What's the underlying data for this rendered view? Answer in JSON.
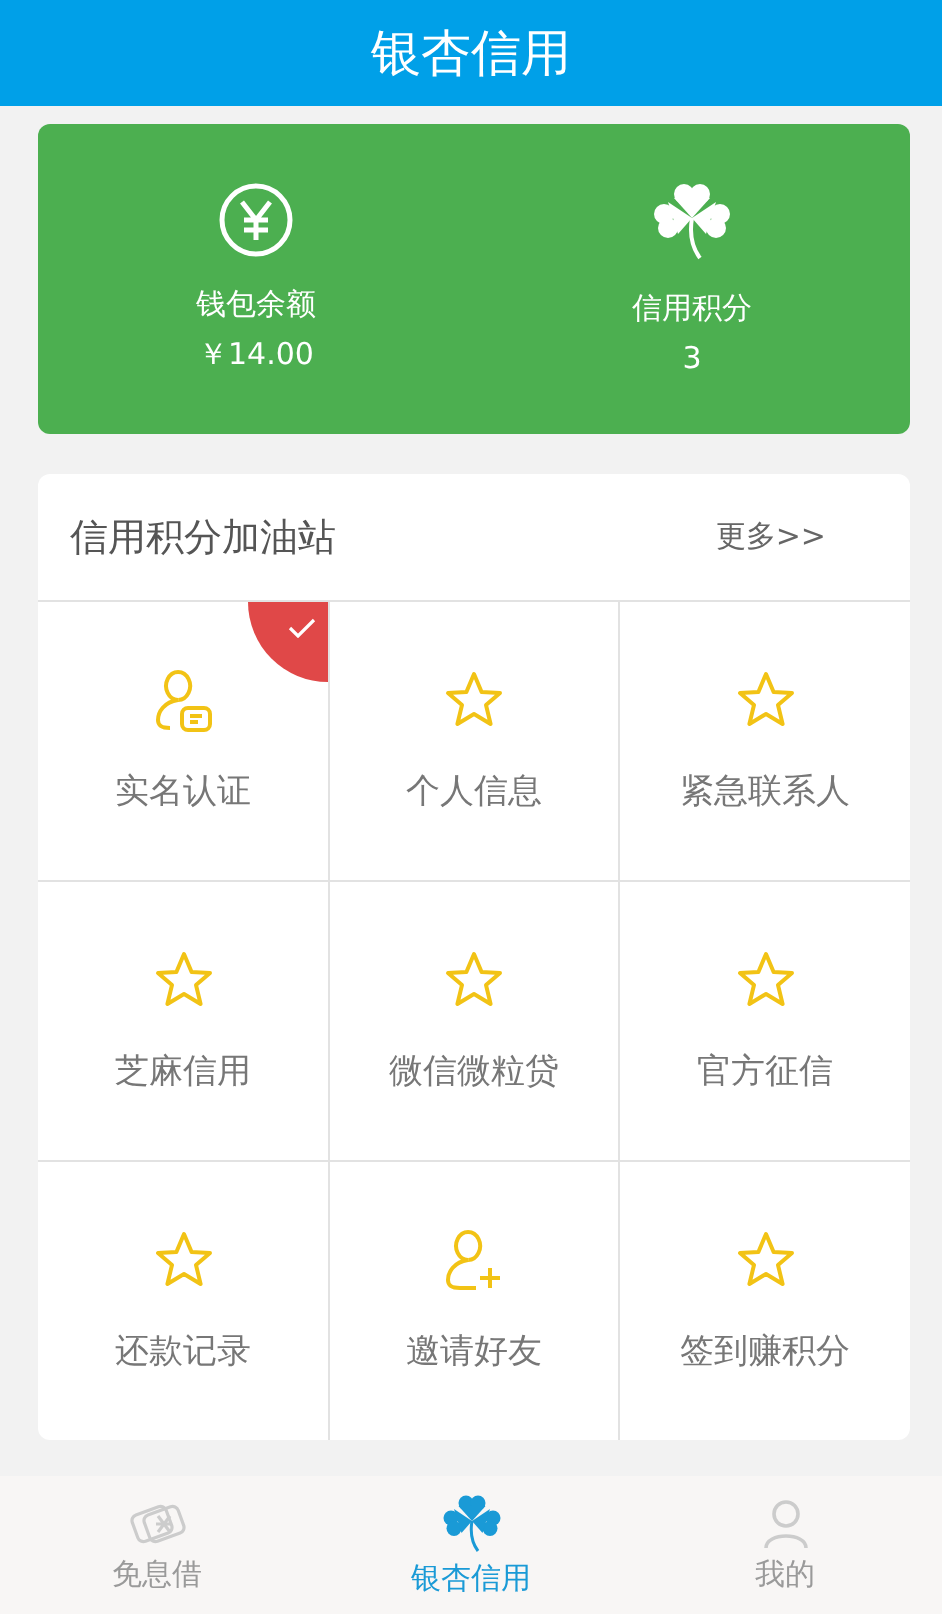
{
  "header": {
    "title": "银杏信用"
  },
  "summary": [
    {
      "kind": "yen",
      "label": "钱包余额",
      "value": "￥14.00"
    },
    {
      "kind": "clover",
      "label": "信用积分",
      "value": "3"
    }
  ],
  "station": {
    "title": "信用积分加油站",
    "more": "更多>>",
    "tiles": [
      {
        "kind": "id",
        "label": "实名认证",
        "done": true
      },
      {
        "kind": "star",
        "label": "个人信息",
        "done": false
      },
      {
        "kind": "star",
        "label": "紧急联系人",
        "done": false
      },
      {
        "kind": "star",
        "label": "芝麻信用",
        "done": false
      },
      {
        "kind": "star",
        "label": "微信微粒贷",
        "done": false
      },
      {
        "kind": "star",
        "label": "官方征信",
        "done": false
      },
      {
        "kind": "star",
        "label": "还款记录",
        "done": false
      },
      {
        "kind": "invite",
        "label": "邀请好友",
        "done": false
      },
      {
        "kind": "star",
        "label": "签到赚积分",
        "done": false
      }
    ]
  },
  "tabbar": [
    {
      "kind": "loan",
      "label": "免息借",
      "selected": false
    },
    {
      "kind": "clover",
      "label": "银杏信用",
      "selected": true
    },
    {
      "kind": "user",
      "label": "我的",
      "selected": false
    }
  ]
}
